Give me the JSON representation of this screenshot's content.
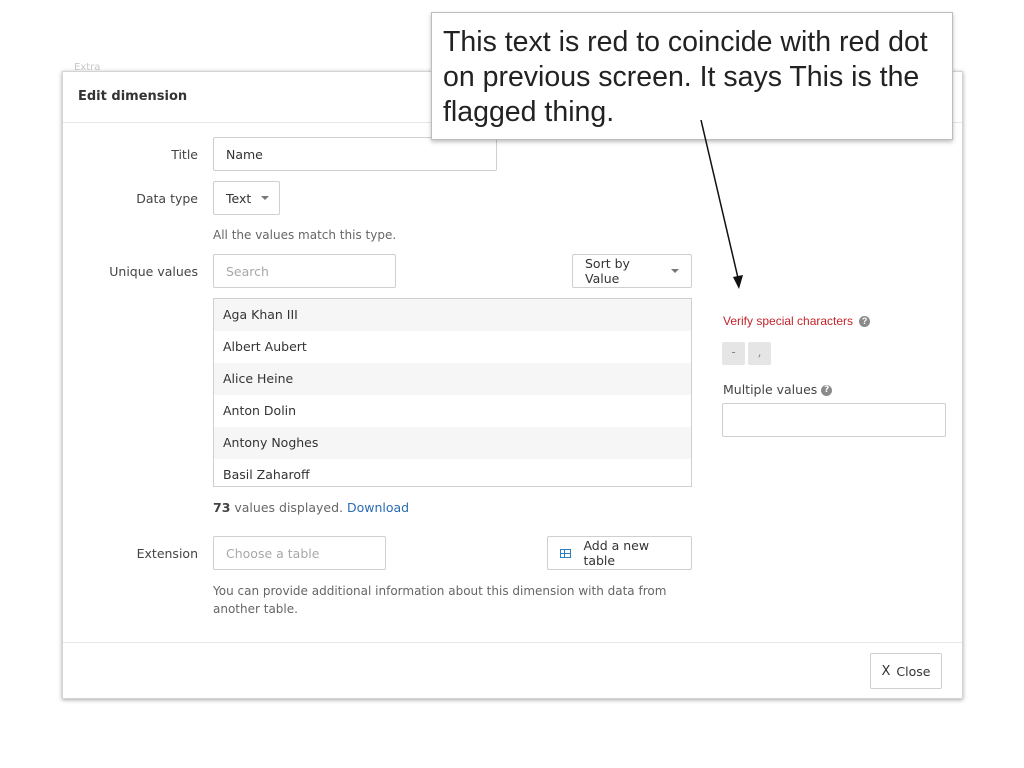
{
  "background": {
    "ghost_label": "Extra"
  },
  "modal": {
    "title": "Edit dimension",
    "title_field": {
      "label": "Title",
      "value": "Name"
    },
    "data_type": {
      "label": "Data type",
      "value": "Text",
      "help": "All the values match this type."
    },
    "unique_values": {
      "label": "Unique values",
      "search_placeholder": "Search",
      "sort_label": "Sort by Value",
      "items": [
        "Aga Khan III",
        "Albert Aubert",
        "Alice Heine",
        "Anton Dolin",
        "Antony Noghes",
        "Basil Zaharoff"
      ],
      "count": "73",
      "count_suffix": " values displayed. ",
      "download_label": "Download"
    },
    "extension": {
      "label": "Extension",
      "placeholder": "Choose a table",
      "add_button": "Add a new table",
      "help": "You can provide additional information about this dimension with data from another table."
    },
    "verify": {
      "label": "Verify special characters",
      "chips": [
        "-",
        ","
      ]
    },
    "multiple_values": {
      "label": "Multiple values",
      "value": ""
    },
    "close": {
      "x": "X",
      "label": "Close"
    }
  },
  "callout": {
    "text": "This text is red to coincide with red dot on previous screen. It says This is the flagged thing."
  },
  "colors": {
    "accent": "#2a6db0",
    "flag_red": "#c3232b"
  }
}
